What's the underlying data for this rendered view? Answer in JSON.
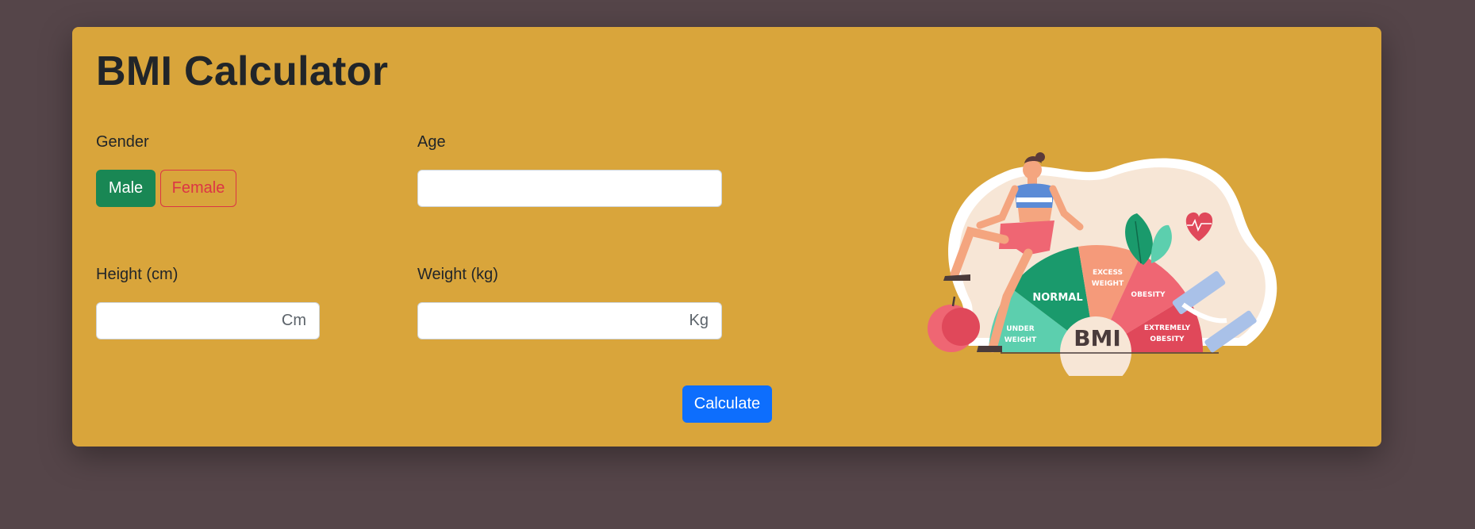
{
  "app": {
    "title": "BMI Calculator"
  },
  "form": {
    "gender_label": "Gender",
    "gender_options": [
      "Male",
      "Female"
    ],
    "gender_selected": "Male",
    "age_label": "Age",
    "age_value": "",
    "height_label": "Height (cm)",
    "height_value": "",
    "height_unit": "Cm",
    "weight_label": "Weight (kg)",
    "weight_value": "",
    "weight_unit": "Kg",
    "calculate_label": "Calculate"
  },
  "illustration": {
    "scale_labels": {
      "under": [
        "UNDER",
        "WEIGHT"
      ],
      "normal": "NORMAL",
      "excess": [
        "EXCESS",
        "WEIGHT"
      ],
      "obesity": "OBESITY",
      "extreme": [
        "EXTREMELY",
        "OBESITY"
      ],
      "center": "BMI"
    }
  },
  "colors": {
    "background": "#554549",
    "card": "#d9a53b",
    "male_button": "#198754",
    "female_button": "#dc3545",
    "calculate_button": "#0d6efd"
  }
}
